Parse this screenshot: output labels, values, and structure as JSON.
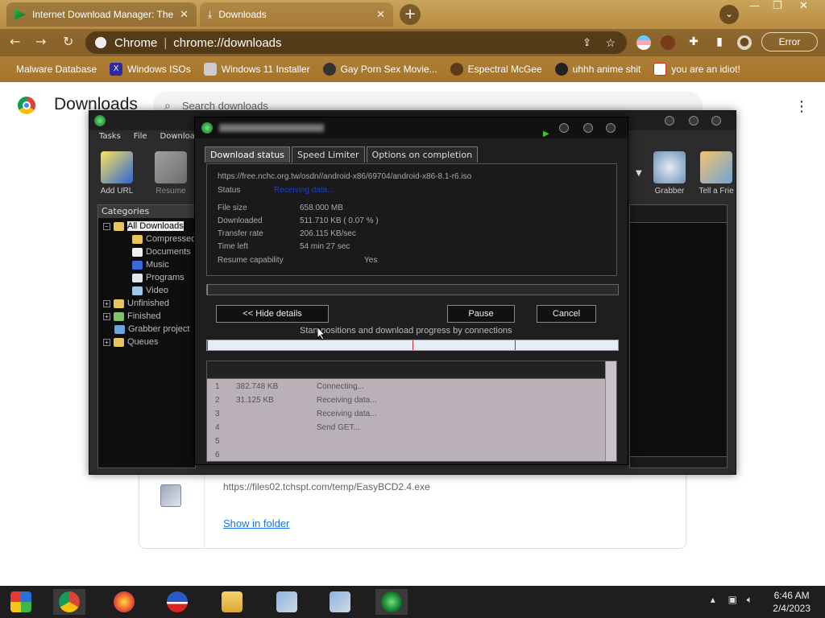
{
  "browser": {
    "tabs": [
      {
        "title": "Internet Download Manager: The"
      },
      {
        "title": "Downloads"
      }
    ],
    "omnibox": {
      "site": "Chrome",
      "url": "chrome://downloads"
    },
    "error_label": "Error",
    "bookmarks": [
      "Malware Database",
      "Windows ISOs",
      "Windows 11 Installer",
      "Gay Porn Sex Movie...",
      "Espectral McGee",
      "uhhh anime shit",
      "you are an idiot!"
    ]
  },
  "downloads_page": {
    "title": "Downloads",
    "search_placeholder": "Search downloads",
    "item_url": "https://files02.tchspt.com/temp/EasyBCD2.4.exe",
    "show_in_folder": "Show in folder"
  },
  "idm": {
    "menu": [
      "Tasks",
      "File",
      "Downloads"
    ],
    "toolbar": {
      "add_url": "Add URL",
      "resume": "Resume",
      "grabber": "Grabber",
      "tell_friend": "Tell a Frie"
    },
    "categories_header": "Categories",
    "categories": [
      "All Downloads",
      "Compressed",
      "Documents",
      "Music",
      "Programs",
      "Video",
      "Unfinished",
      "Finished",
      "Grabber project",
      "Queues"
    ]
  },
  "progress_dialog": {
    "tabs": [
      "Download status",
      "Speed Limiter",
      "Options on completion"
    ],
    "url": "https://free.nchc.org.tw/osdn//android-x86/69704/android-x86-8.1-r6.iso",
    "status_label": "Status",
    "status_value": "Receiving data...",
    "fields": [
      {
        "label": "File size",
        "value": "658.000  MB"
      },
      {
        "label": "Downloaded",
        "value": "511.710  KB  ( 0.07 % )"
      },
      {
        "label": "Transfer rate",
        "value": "206.115  KB/sec"
      },
      {
        "label": "Time left",
        "value": "54 min 27 sec"
      },
      {
        "label": "Resume capability",
        "value": "Yes"
      }
    ],
    "progress_fraction": 0.0007,
    "hide_details": "<< Hide details",
    "pause": "Pause",
    "cancel": "Cancel",
    "caption": "Start positions and download progress by connections",
    "connections": [
      {
        "n": "1",
        "downloaded": "382.748  KB",
        "info": "Connecting..."
      },
      {
        "n": "2",
        "downloaded": "31.125  KB",
        "info": "Receiving data..."
      },
      {
        "n": "3",
        "downloaded": "",
        "info": "Receiving data..."
      },
      {
        "n": "4",
        "downloaded": "",
        "info": "Send GET..."
      },
      {
        "n": "5",
        "downloaded": "",
        "info": ""
      },
      {
        "n": "6",
        "downloaded": "",
        "info": ""
      }
    ]
  },
  "taskbar": {
    "time": "6:46 AM",
    "date": "2/4/2023"
  }
}
